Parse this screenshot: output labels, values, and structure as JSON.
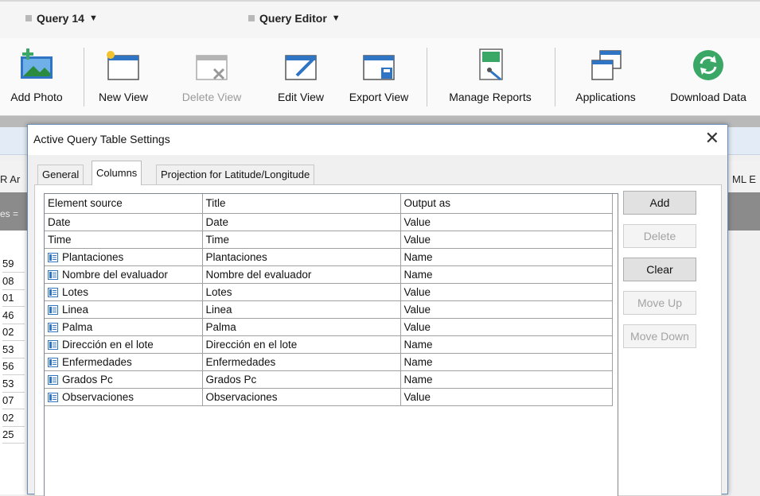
{
  "topbar": {
    "query_tab": "Query 14",
    "editor_tab": "Query Editor"
  },
  "toolbar": {
    "add_photo": "Add Photo",
    "new_view": "New View",
    "delete_view": "Delete View",
    "edit_view": "Edit View",
    "export_view": "Export View",
    "manage_reports": "Manage Reports",
    "applications": "Applications",
    "download_data": "Download Data"
  },
  "background": {
    "left_tab_fragment": "R Ar",
    "right_tab_fragment": "ML E",
    "dark_fragment": "es =",
    "row_numbers": [
      "59",
      "08",
      "01",
      "46",
      "02",
      "53",
      "56",
      "53",
      "07",
      "02",
      "25"
    ]
  },
  "dialog": {
    "title": "Active Query Table Settings",
    "tabs": [
      "General",
      "Columns",
      "Projection for Latitude/Longitude"
    ],
    "columns": {
      "headers": [
        "Element source",
        "Title",
        "Output as"
      ],
      "rows": [
        {
          "source": "Date",
          "title": "Date",
          "output": "Value",
          "icon": false
        },
        {
          "source": "Time",
          "title": "Time",
          "output": "Value",
          "icon": false
        },
        {
          "source": "Plantaciones",
          "title": "Plantaciones",
          "output": "Name",
          "icon": true
        },
        {
          "source": "Nombre del evaluador",
          "title": "Nombre del evaluador",
          "output": "Name",
          "icon": true
        },
        {
          "source": "Lotes",
          "title": "Lotes",
          "output": "Value",
          "icon": true
        },
        {
          "source": "Linea",
          "title": "Linea",
          "output": "Value",
          "icon": true
        },
        {
          "source": "Palma",
          "title": "Palma",
          "output": "Value",
          "icon": true
        },
        {
          "source": "Dirección en el lote",
          "title": "Dirección en el lote",
          "output": "Name",
          "icon": true
        },
        {
          "source": "Enfermedades",
          "title": "Enfermedades",
          "output": "Name",
          "icon": true
        },
        {
          "source": "Grados Pc",
          "title": "Grados Pc",
          "output": "Name",
          "icon": true
        },
        {
          "source": "Observaciones",
          "title": "Observaciones",
          "output": "Value",
          "icon": true
        }
      ]
    },
    "buttons": {
      "add": "Add",
      "delete": "Delete",
      "clear": "Clear",
      "move_up": "Move Up",
      "move_down": "Move Down"
    }
  },
  "colors": {
    "accent_blue": "#2f75c4",
    "download_green": "#3aa766",
    "dialog_border": "#6a8fba"
  }
}
